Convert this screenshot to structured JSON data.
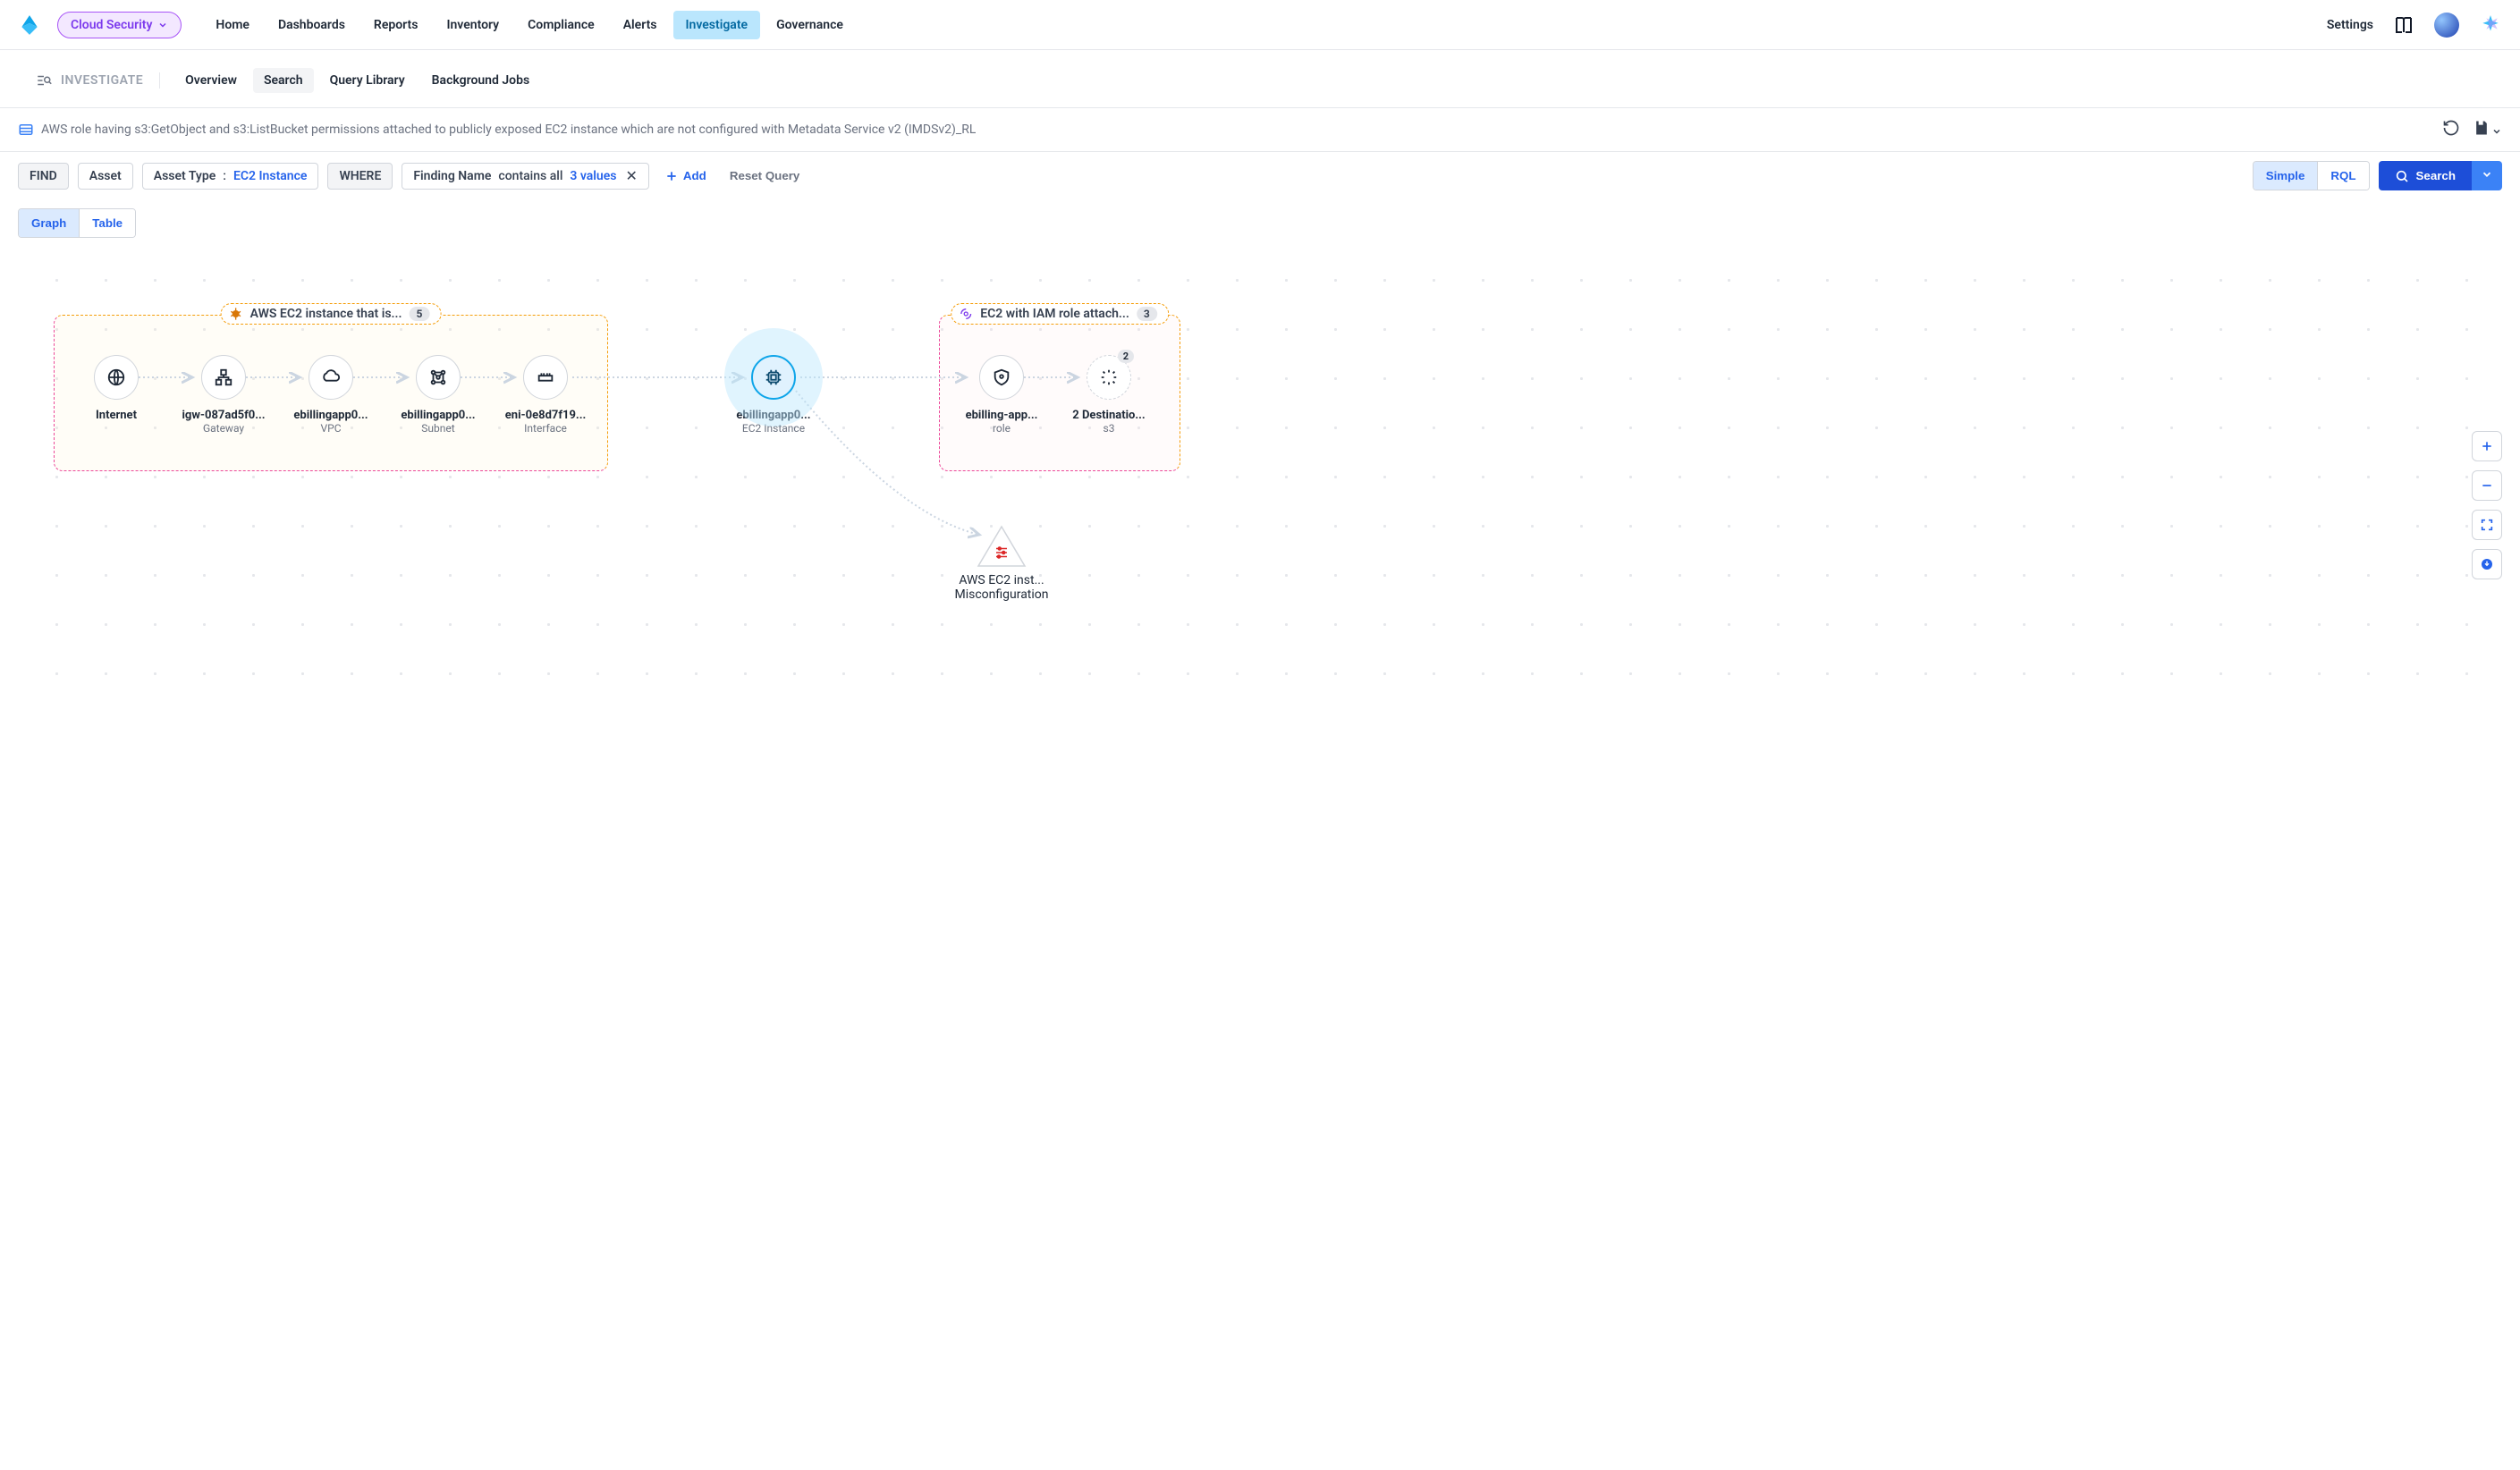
{
  "header": {
    "product": "Cloud Security",
    "nav": [
      "Home",
      "Dashboards",
      "Reports",
      "Inventory",
      "Compliance",
      "Alerts",
      "Investigate",
      "Governance"
    ],
    "active_nav": "Investigate",
    "settings": "Settings"
  },
  "subheader": {
    "crumb": "INVESTIGATE",
    "tabs": [
      "Overview",
      "Search",
      "Query Library",
      "Background Jobs"
    ],
    "active_tab": "Search"
  },
  "query": {
    "name": "AWS role having s3:GetObject and s3:ListBucket permissions attached to publicly exposed EC2 instance which are not configured with Metadata Service v2 (IMDSv2)_RL",
    "find_label": "FIND",
    "asset_label": "Asset",
    "asset_type_label": "Asset Type",
    "asset_type_value": "EC2 Instance",
    "where_label": "WHERE",
    "finding_label": "Finding Name",
    "finding_op": "contains all",
    "finding_values_text": "3 values",
    "add_label": "Add",
    "reset_label": "Reset Query",
    "mode_simple": "Simple",
    "mode_rql": "RQL",
    "search_label": "Search",
    "view_graph": "Graph",
    "view_table": "Table"
  },
  "graph": {
    "group_left": {
      "title": "AWS EC2 instance that is...",
      "count": "5"
    },
    "group_right": {
      "title": "EC2 with IAM role attach...",
      "count": "3"
    },
    "nodes": {
      "internet": {
        "label": "Internet",
        "sub": ""
      },
      "gateway": {
        "label": "igw-087ad5f0...",
        "sub": "Gateway"
      },
      "vpc": {
        "label": "ebillingapp0...",
        "sub": "VPC"
      },
      "subnet": {
        "label": "ebillingapp0...",
        "sub": "Subnet"
      },
      "interface": {
        "label": "eni-0e8d7f19...",
        "sub": "Interface"
      },
      "ec2": {
        "label": "ebillingapp0...",
        "sub": "EC2 Instance"
      },
      "role": {
        "label": "ebilling-app...",
        "sub": "role"
      },
      "s3": {
        "label": "2 Destinatio...",
        "sub": "s3",
        "badge": "2"
      },
      "misconfig": {
        "label": "AWS EC2 inst...",
        "sub": "Misconfiguration"
      }
    }
  }
}
